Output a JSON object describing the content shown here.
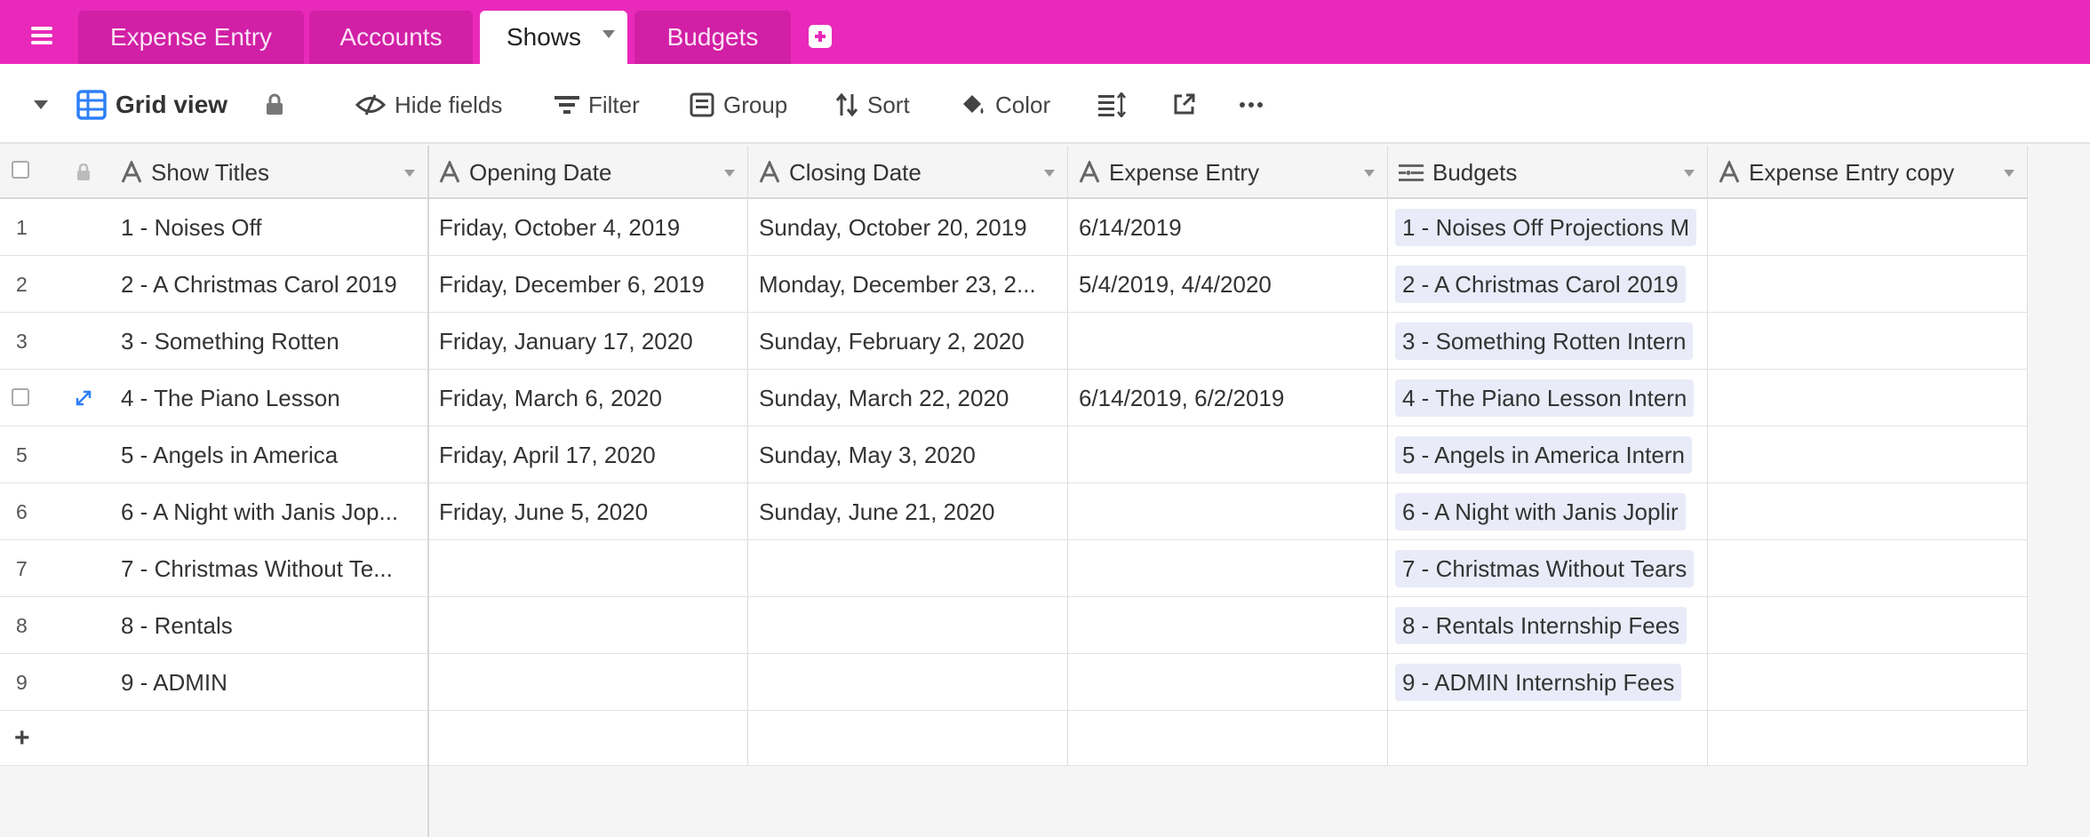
{
  "tabs": [
    {
      "label": "Expense Entry",
      "active": false
    },
    {
      "label": "Accounts",
      "active": false
    },
    {
      "label": "Shows",
      "active": true
    },
    {
      "label": "Budgets",
      "active": false
    }
  ],
  "toolbar": {
    "view_name": "Grid view",
    "hide_fields": "Hide fields",
    "filter": "Filter",
    "group": "Group",
    "sort": "Sort",
    "color": "Color"
  },
  "columns": {
    "show_titles": "Show Titles",
    "opening_date": "Opening Date",
    "closing_date": "Closing Date",
    "expense_entry": "Expense Entry",
    "budgets": "Budgets",
    "expense_entry_copy": "Expense Entry copy"
  },
  "rows": [
    {
      "num": "1",
      "title": "1 - Noises Off",
      "opening": "Friday, October 4, 2019",
      "closing": "Sunday, October 20, 2019",
      "expense": "6/14/2019",
      "budget": "1 - Noises Off Projections M"
    },
    {
      "num": "2",
      "title": "2 - A Christmas Carol 2019",
      "opening": "Friday, December 6, 2019",
      "closing": "Monday, December 23, 2...",
      "expense": "5/4/2019, 4/4/2020",
      "budget": "2 - A Christmas Carol 2019"
    },
    {
      "num": "3",
      "title": "3 - Something Rotten",
      "opening": "Friday, January 17, 2020",
      "closing": "Sunday, February 2, 2020",
      "expense": "",
      "budget": "3 - Something Rotten Intern"
    },
    {
      "num": "",
      "title": "4 - The Piano Lesson",
      "opening": "Friday, March 6, 2020",
      "closing": "Sunday, March 22, 2020",
      "expense": "6/14/2019, 6/2/2019",
      "budget": "4 - The Piano Lesson Intern"
    },
    {
      "num": "5",
      "title": "5 - Angels in America",
      "opening": "Friday, April 17, 2020",
      "closing": "Sunday, May 3, 2020",
      "expense": "",
      "budget": "5 - Angels in America Intern"
    },
    {
      "num": "6",
      "title": "6 - A Night with Janis Jop...",
      "opening": "Friday, June 5, 2020",
      "closing": "Sunday, June 21, 2020",
      "expense": "",
      "budget": "6 - A Night with Janis Joplir"
    },
    {
      "num": "7",
      "title": "7 - Christmas Without Te...",
      "opening": "",
      "closing": "",
      "expense": "",
      "budget": "7 - Christmas Without Tears"
    },
    {
      "num": "8",
      "title": "8 - Rentals",
      "opening": "",
      "closing": "",
      "expense": "",
      "budget": "8 - Rentals Internship Fees"
    },
    {
      "num": "9",
      "title": "9 - ADMIN",
      "opening": "",
      "closing": "",
      "expense": "",
      "budget": "9 - ADMIN Internship Fees"
    }
  ],
  "add_row_label": "+",
  "colors": {
    "tabbar": "#e929ba",
    "tab_inactive": "#d11fa6",
    "grid_icon": "#2d7ff9",
    "pill": "#e9ebf8"
  },
  "icons": [
    "menu-icon",
    "add-tab-icon",
    "collapse-caret-icon",
    "grid-view-icon",
    "lock-icon",
    "hide-fields-icon",
    "filter-icon",
    "group-icon",
    "sort-icon",
    "color-bucket-icon",
    "row-height-icon",
    "share-icon",
    "more-icon",
    "text-field-icon",
    "link-field-icon",
    "expand-record-icon"
  ]
}
